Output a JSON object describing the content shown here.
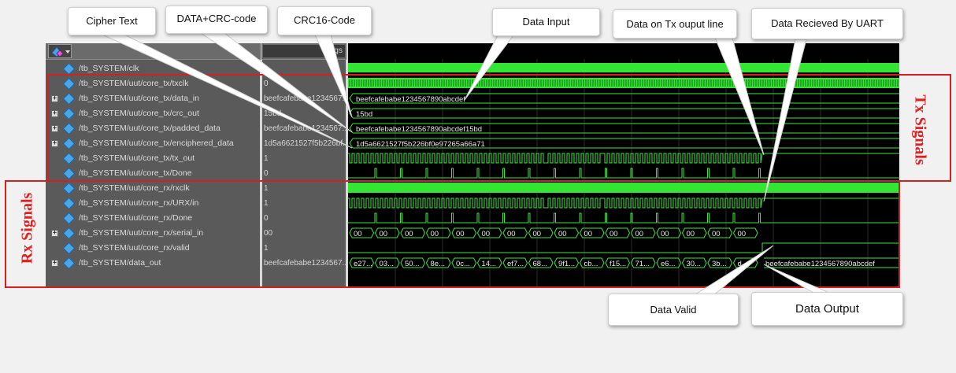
{
  "toolbar": {
    "msgs_label": "Msgs"
  },
  "signals": [
    {
      "name": "/tb_SYSTEM/clk",
      "value": "0",
      "expandable": false
    },
    {
      "name": "/tb_SYSTEM/uut/core_tx/txclk",
      "value": "0",
      "expandable": false
    },
    {
      "name": "/tb_SYSTEM/uut/core_tx/data_in",
      "value": "beefcafebabe1234567...",
      "expandable": true
    },
    {
      "name": "/tb_SYSTEM/uut/core_tx/crc_out",
      "value": "15bd",
      "expandable": true
    },
    {
      "name": "/tb_SYSTEM/uut/core_tx/padded_data",
      "value": "beefcafebabe1234567...",
      "expandable": true
    },
    {
      "name": "/tb_SYSTEM/uut/core_tx/enciphered_data",
      "value": "1d5a6621527f5b226bf...",
      "expandable": true
    },
    {
      "name": "/tb_SYSTEM/uut/core_tx/tx_out",
      "value": "1",
      "expandable": false
    },
    {
      "name": "/tb_SYSTEM/uut/core_tx/Done",
      "value": "0",
      "expandable": false
    },
    {
      "name": "/tb_SYSTEM/uut/core_rx/rxclk",
      "value": "1",
      "expandable": false
    },
    {
      "name": "/tb_SYSTEM/uut/core_rx/URX/in",
      "value": "1",
      "expandable": false
    },
    {
      "name": "/tb_SYSTEM/uut/core_rx/Done",
      "value": "0",
      "expandable": false
    },
    {
      "name": "/tb_SYSTEM/uut/core_rx/serial_in",
      "value": "00",
      "expandable": true
    },
    {
      "name": "/tb_SYSTEM/uut/core_rx/valid",
      "value": "1",
      "expandable": false
    },
    {
      "name": "/tb_SYSTEM/data_out",
      "value": "beefcafebabe1234567...",
      "expandable": true
    }
  ],
  "waves": {
    "data_in": "beefcafebabe1234567890abcdef",
    "crc_out": "15bd",
    "padded_data": "beefcafebabe1234567890abcdef15bd",
    "enciphered_data": "1d5a6621527f5b226bf0e97265a66a71",
    "serial_in_values": [
      "00",
      "00",
      "00",
      "00",
      "00",
      "00",
      "00",
      "00",
      "00",
      "00",
      "00",
      "00",
      "00",
      "00",
      "00",
      "00"
    ],
    "data_out_values": [
      "e27...",
      "03...",
      "50...",
      "8e...",
      "0c...",
      "14...",
      "ef7...",
      "68...",
      "9f1...",
      "cb...",
      "f15...",
      "71...",
      "e6...",
      "30...",
      "3b...",
      "d..."
    ],
    "data_out_final": "beefcafebabe1234567890abcdef"
  },
  "callouts": {
    "cipher_text": "Cipher Text",
    "data_crc": "DATA+CRC-code",
    "crc16": "CRC16-Code",
    "data_input": "Data Input",
    "data_tx": "Data on Tx ouput line",
    "data_uart": "Data Recieved By UART",
    "data_valid": "Data Valid",
    "data_output": "Data Output"
  },
  "labels": {
    "tx_signals": "Tx Signals",
    "rx_signals": "Rx Signals"
  },
  "colors": {
    "wave": "#3fe23f",
    "clock_fill": "#33e633",
    "highlight_box": "#d42020",
    "background": "#000000"
  }
}
